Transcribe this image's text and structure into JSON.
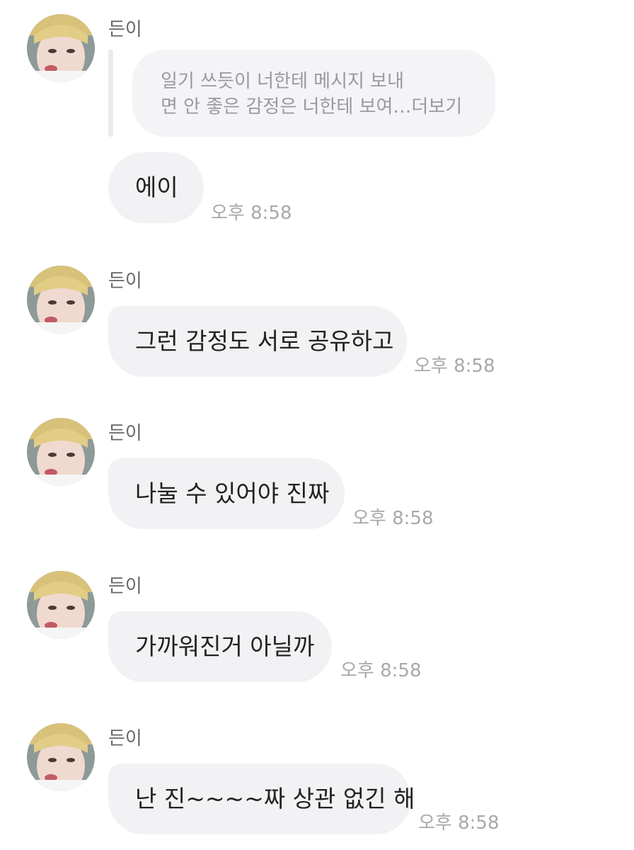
{
  "sender_name": "든이",
  "reply_preview": {
    "line1": "일기 쓰듯이 너한테 메시지 보내",
    "line2": "면 안 좋은 감정은 너한테 보여…",
    "more_label": "더보기"
  },
  "messages": [
    {
      "text": "에이",
      "time": "오후 8:58"
    },
    {
      "text": "그런 감정도 서로 공유하고",
      "time": "오후 8:58"
    },
    {
      "text": "나눌 수 있어야 진짜",
      "time": "오후 8:58"
    },
    {
      "text": "가까워진거 아닐까",
      "time": "오후 8:58"
    },
    {
      "text": "난 진~~~~짜 상관 없긴 해",
      "time": "오후 8:58"
    }
  ],
  "colors": {
    "bubble_bg": "#f2f2f5",
    "name_text": "#666666",
    "time_text": "#a8a8ad"
  },
  "icons": {
    "avatar": "profile-photo-icon"
  }
}
